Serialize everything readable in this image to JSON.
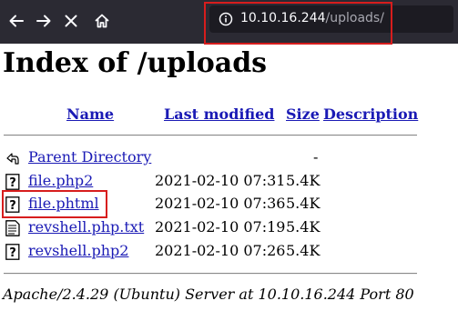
{
  "browser": {
    "url_host": "10.10.16.244",
    "url_path": "/uploads/"
  },
  "page": {
    "title": "Index of /uploads",
    "columns": {
      "name": "Name",
      "last_modified": "Last modified",
      "size": "Size",
      "description": "Description"
    },
    "parent": {
      "label": "Parent Directory",
      "size": "-"
    },
    "files": [
      {
        "name": "file.php2",
        "modified": "2021-02-10 07:31",
        "size": "5.4K",
        "icon": "unknown-file-icon"
      },
      {
        "name": "file.phtml",
        "modified": "2021-02-10 07:36",
        "size": "5.4K",
        "icon": "unknown-file-icon"
      },
      {
        "name": "revshell.php.txt",
        "modified": "2021-02-10 07:19",
        "size": "5.4K",
        "icon": "text-file-icon"
      },
      {
        "name": "revshell.php2",
        "modified": "2021-02-10 07:26",
        "size": "5.4K",
        "icon": "unknown-file-icon"
      }
    ],
    "address": "Apache/2.4.29 (Ubuntu) Server at 10.10.16.244 Port 80"
  },
  "colors": {
    "toolbar": "#2b2a33",
    "link": "#1a1ab5",
    "highlight": "#d71d1d"
  }
}
